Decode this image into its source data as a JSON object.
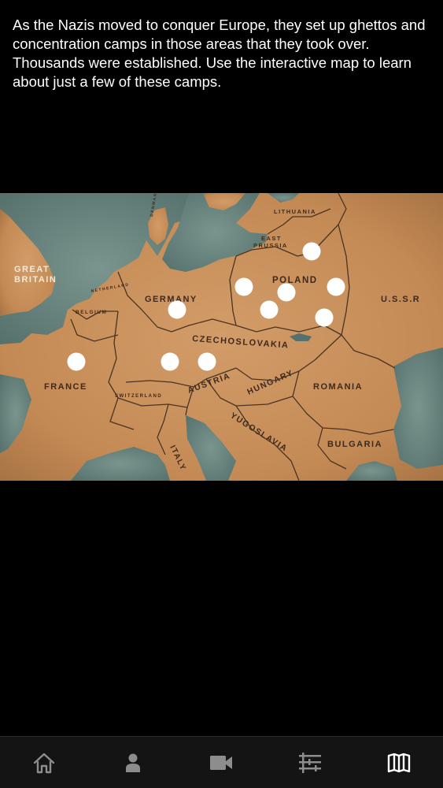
{
  "intro": {
    "text": "As the Nazis moved to conquer Europe, they set up ghettos and concentration camps in those areas that they took over. Thousands were established. Use the interactive map to learn about just a few of these camps."
  },
  "map": {
    "labels": {
      "lithuania": "LITHUANIA",
      "east": "EAST",
      "prussia": "PRUSSIA",
      "great": "GREAT",
      "britain": "BRITAIN",
      "poland": "POLAND",
      "ussr": "U.S.S.R",
      "germany": "GERMANY",
      "belgium": "BELGIUM",
      "netherland": "NETHERLAND",
      "denmark": "DENMARK",
      "czechoslovakia": "CZECHOSLOVAKIA",
      "france": "FRANCE",
      "austria": "AUSTRIA",
      "hungary": "HUNGARY",
      "romania": "ROMANIA",
      "switzerland": "SWITZERLAND",
      "yugoslavia": "YUGOSLAVIA",
      "bulgaria": "BULGARIA",
      "italy": "ITALY"
    }
  },
  "colors": {
    "background": "#000000",
    "land": "#c8925f",
    "sea": "#6f8a84",
    "marker": "#ffffff",
    "tabbar": "#141414",
    "tab_icon": "#8d8d8d",
    "tab_icon_active": "#ffffff"
  },
  "tabs": [
    {
      "icon": "home-icon",
      "active": false
    },
    {
      "icon": "person-icon",
      "active": false
    },
    {
      "icon": "video-camera-icon",
      "active": false
    },
    {
      "icon": "timeline-icon",
      "active": false
    },
    {
      "icon": "map-icon",
      "active": true
    }
  ]
}
